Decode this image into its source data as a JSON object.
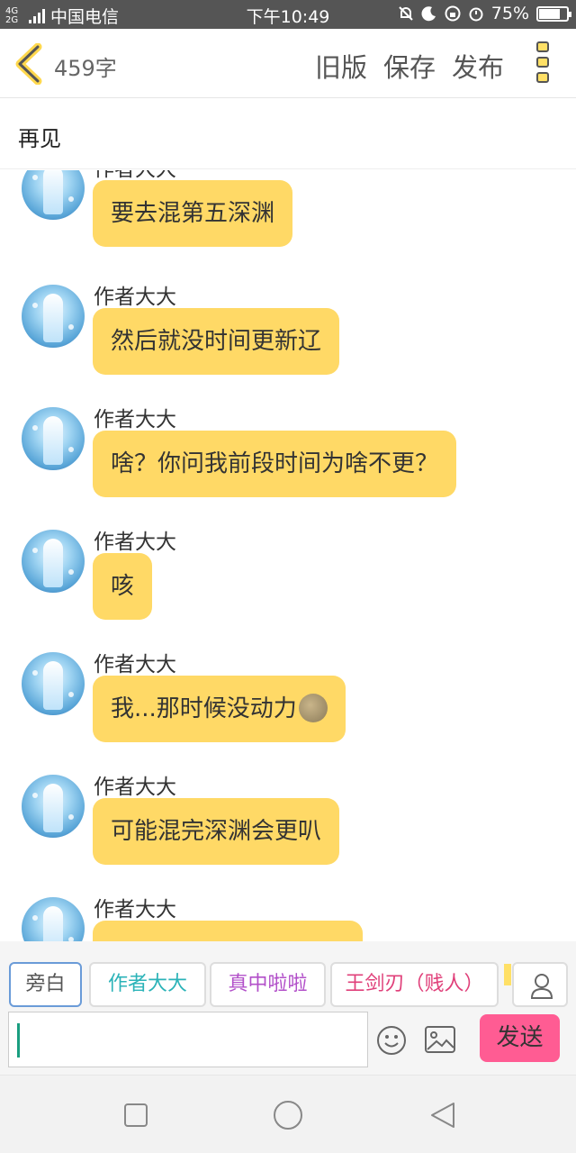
{
  "status_bar": {
    "network_top": "4G",
    "network_bottom": "2G",
    "carrier": "中国电信",
    "time": "下午10:49",
    "battery": "75%",
    "battery_level": 0.75
  },
  "top_bar": {
    "word_count": "459字",
    "actions": [
      "旧版",
      "保存",
      "发布"
    ]
  },
  "title": "再见",
  "messages": [
    {
      "sender": "作者大大",
      "text": "要去混第五深渊"
    },
    {
      "sender": "作者大大",
      "text": "然后就没时间更新辽"
    },
    {
      "sender": "作者大大",
      "text": "啥？你问我前段时间为啥不更？"
    },
    {
      "sender": "作者大大",
      "text": "咳"
    },
    {
      "sender": "作者大大",
      "text": "我...那时候没动力",
      "emoji": "moon-face-emoji"
    },
    {
      "sender": "作者大大",
      "text": "可能混完深渊会更叭"
    },
    {
      "sender": "作者大大",
      "text": ""
    }
  ],
  "role_chips": [
    {
      "label": "旁白",
      "color": "#555555",
      "active": true
    },
    {
      "label": "作者大大",
      "color": "#2bb3b8",
      "active": false
    },
    {
      "label": "真中啦啦",
      "color": "#b24fc9",
      "active": false
    },
    {
      "label": "王剑刃（贱人）",
      "color": "#e0407a",
      "active": false
    }
  ],
  "composer": {
    "input_value": "",
    "send_label": "发送"
  },
  "colors": {
    "bubble": "#ffd966",
    "send_button": "#ff5c93",
    "accent_yellow": "#ffe066"
  },
  "icons": {
    "back": "back-chevron-icon",
    "more": "more-vertical-icon",
    "emoji": "smiley-icon",
    "image": "image-icon",
    "add_role": "person-icon",
    "nav_recent": "square-icon",
    "nav_home": "circle-icon",
    "nav_back": "triangle-back-icon"
  }
}
